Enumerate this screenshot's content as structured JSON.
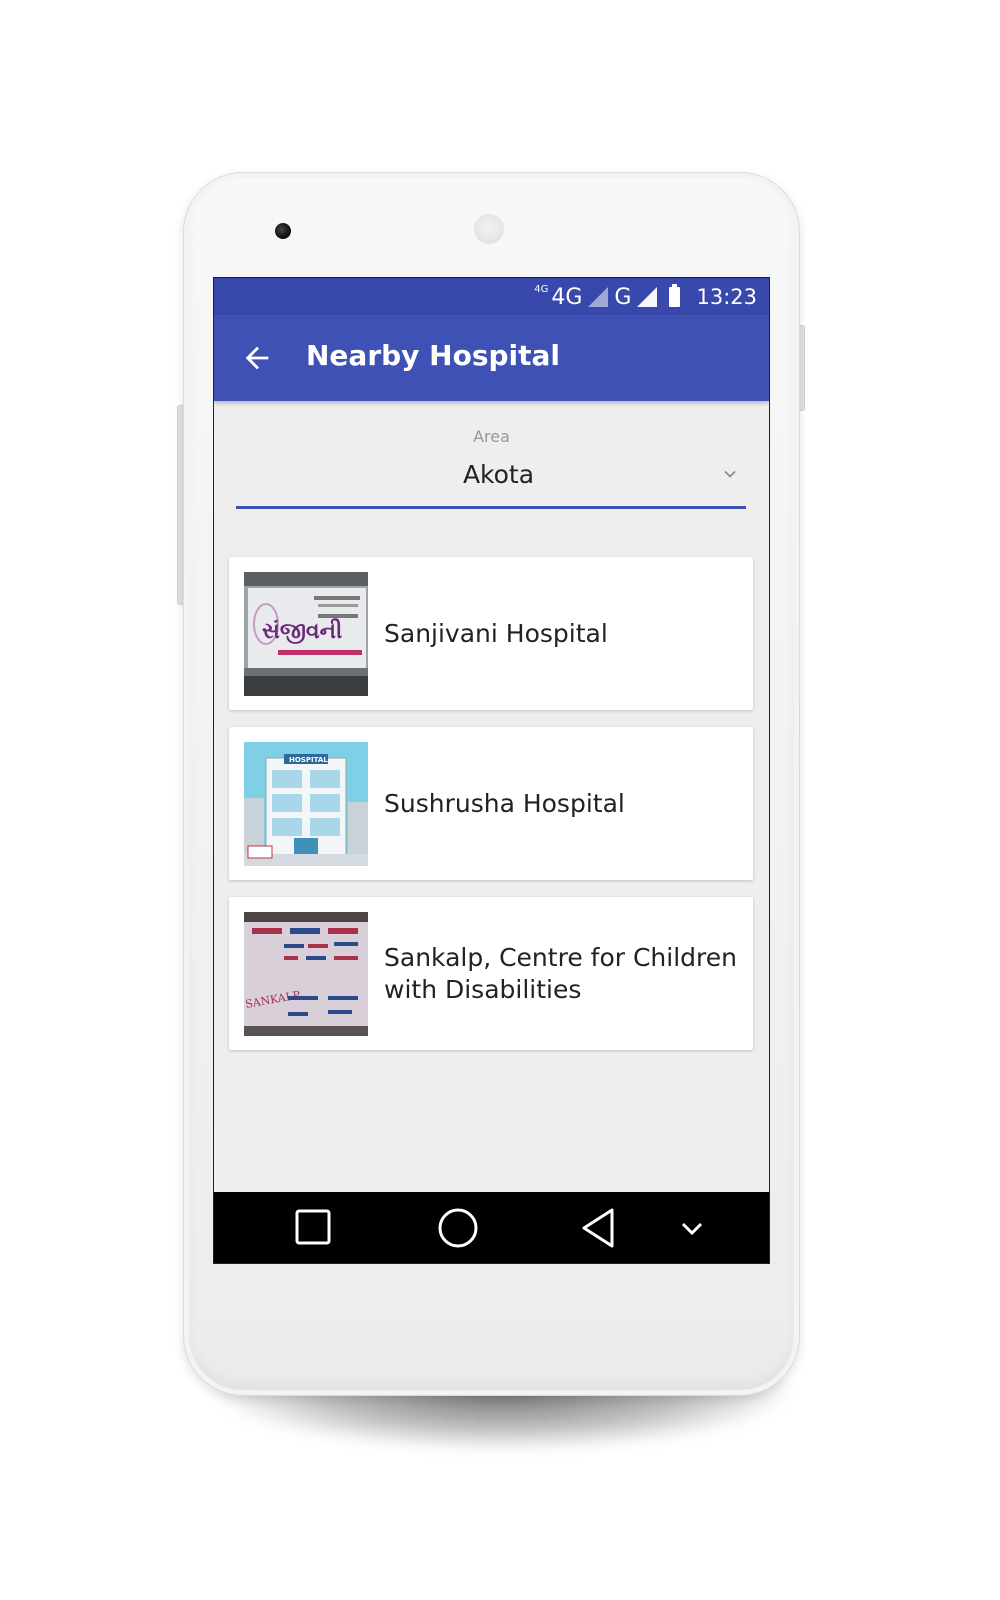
{
  "status_bar": {
    "network_small": "4G",
    "network_main": "4G",
    "network_secondary": "G",
    "time": "13:23",
    "icons": [
      "signal-icon",
      "signal-icon",
      "battery-icon"
    ]
  },
  "app_bar": {
    "title": "Nearby Hospital",
    "back_icon": "arrow-left-icon"
  },
  "filter": {
    "label": "Area",
    "selected": "Akota",
    "dropdown_icon": "chevron-down-icon"
  },
  "hospitals": [
    {
      "name": "Sanjivani Hospital"
    },
    {
      "name": "Sushrusha Hospital"
    },
    {
      "name": "Sankalp, Centre for Children with Disabilities"
    }
  ],
  "thumbnail_text": {
    "sanjivani_sign": "સંજીવની",
    "sushrusha_sign": "HOSPITAL",
    "sankalp_sign": "SANKALP"
  },
  "nav_bar": {
    "icons": [
      "square-icon",
      "circle-icon",
      "triangle-back-icon",
      "chevron-down-icon"
    ]
  },
  "colors": {
    "primary": "#3f51b5",
    "primary_dark": "#3949ab",
    "background": "#eeeeee"
  }
}
